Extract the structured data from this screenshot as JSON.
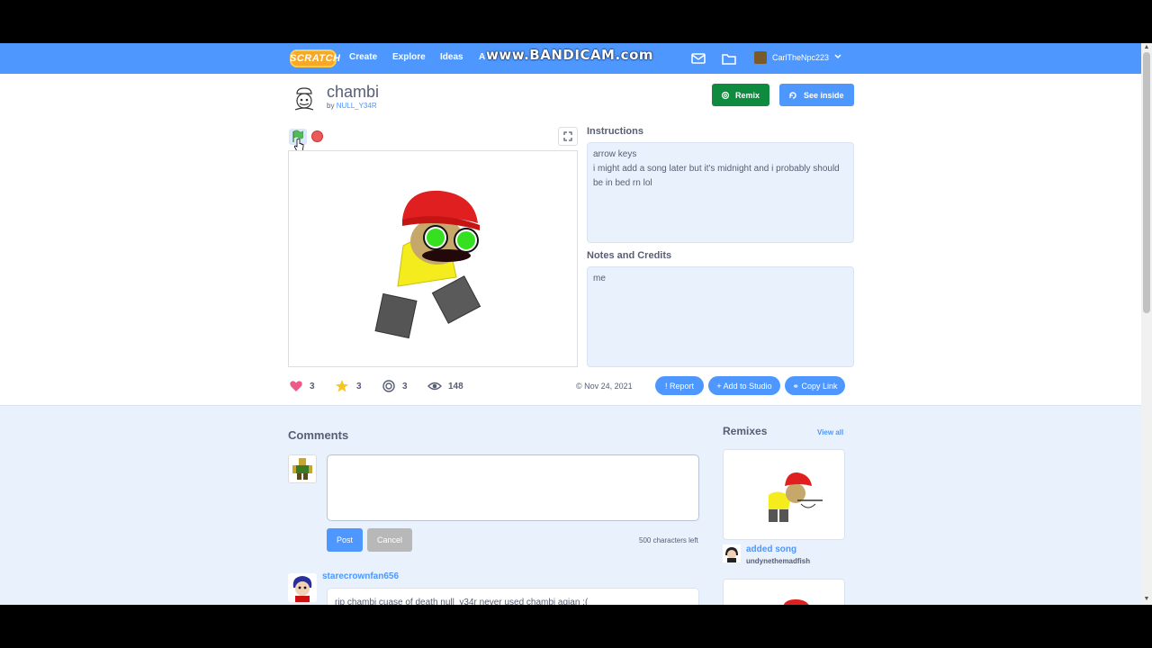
{
  "watermark": "www.BANDICAM.com",
  "nav": {
    "logo": "SCRATCH",
    "links": [
      "Create",
      "Explore",
      "Ideas",
      "A"
    ],
    "username": "CarlTheNpc223"
  },
  "project": {
    "title": "chambi",
    "by_prefix": "by",
    "author": "NULL_Y34R",
    "remix_label": "Remix",
    "see_inside_label": "See inside",
    "instructions_title": "Instructions",
    "instructions": "arrow keys\ni might add a song later but it's midnight and i probably should be in bed rn lol",
    "notes_title": "Notes and Credits",
    "notes": "me"
  },
  "stats": {
    "loves": "3",
    "favorites": "3",
    "remixes": "3",
    "views": "148",
    "date": "Nov 24, 2021",
    "report_label": "Report",
    "add_to_studio_label": "Add to Studio",
    "copy_link_label": "Copy Link"
  },
  "comments": {
    "title": "Comments",
    "post_label": "Post",
    "cancel_label": "Cancel",
    "chars_left": "500 characters left",
    "items": [
      {
        "user": "starecrownfan656",
        "text": "rip chambi cuase of death null_y34r never used chambi agian :("
      }
    ]
  },
  "remixes": {
    "title": "Remixes",
    "view_all": "View all",
    "items": [
      {
        "name": "added song",
        "author": "undynethemadfish"
      }
    ]
  },
  "colors": {
    "nav_blue": "#4d97ff",
    "remix_green": "#0f8b3f",
    "panel_blue": "#e9f1fc",
    "text": "#575e75",
    "stop_red": "#ec5959"
  }
}
